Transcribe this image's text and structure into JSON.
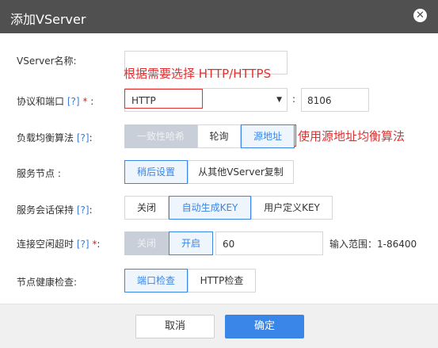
{
  "dialog": {
    "title": "添加VServer",
    "close_icon": "close-icon"
  },
  "fields": {
    "name": {
      "label": "VServer名称:",
      "value": ""
    },
    "protocol_port": {
      "label": "协议和端口",
      "help": "[?]",
      "required": "*",
      "suffix": ":",
      "protocol": "HTTP",
      "separator": ":",
      "port": "8106"
    },
    "lb_algorithm": {
      "label": "负载均衡算法",
      "help": "[?]",
      "suffix": ":",
      "options": [
        "一致性哈希",
        "轮询",
        "源地址"
      ]
    },
    "service_node": {
      "label": "服务节点 :",
      "options": [
        "稍后设置",
        "从其他VServer复制"
      ]
    },
    "session_persistence": {
      "label": "服务会话保持",
      "help": "[?]",
      "suffix": ":",
      "options": [
        "关闭",
        "自动生成KEY",
        "用户定义KEY"
      ]
    },
    "idle_timeout": {
      "label": "连接空闲超时",
      "help": "[?]",
      "required": "*",
      "suffix": ":",
      "options": [
        "关闭",
        "开启"
      ],
      "value": "60",
      "range_text": "输入范围：1-86400"
    },
    "health_check": {
      "label": "节点健康检查:",
      "options": [
        "端口检查",
        "HTTP检查"
      ]
    }
  },
  "annotations": {
    "protocol_hint": "根据需要选择 HTTP/HTTPS",
    "algorithm_hint": "使用源地址均衡算法",
    "color": "#e03030"
  },
  "footer": {
    "cancel": "取消",
    "confirm": "确定"
  },
  "colors": {
    "accent": "#3a86e8",
    "titlebar": "#505050",
    "annotation": "#e03030"
  }
}
